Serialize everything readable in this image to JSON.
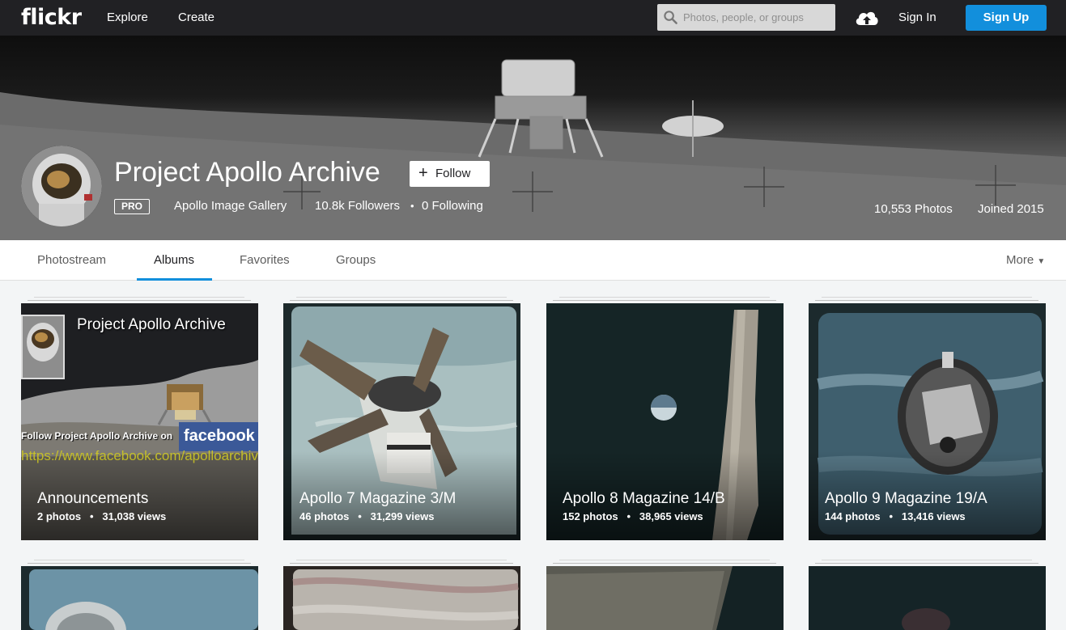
{
  "nav": {
    "logo": "flickr",
    "explore": "Explore",
    "create": "Create",
    "search_placeholder": "Photos, people, or groups",
    "sign_in": "Sign In",
    "sign_up": "Sign Up",
    "upload_icon": "cloud-upload-icon"
  },
  "profile": {
    "name": "Project Apollo Archive",
    "follow": "Follow",
    "badge": "PRO",
    "subtitle": "Apollo Image Gallery",
    "followers": "10.8k Followers",
    "following": "0 Following",
    "photos": "10,553 Photos",
    "joined": "Joined 2015"
  },
  "tabs": {
    "photostream": "Photostream",
    "albums": "Albums",
    "favorites": "Favorites",
    "groups": "Groups",
    "more": "More"
  },
  "albums": [
    {
      "title": "Announcements",
      "photos": "2 photos",
      "views": "31,038 views",
      "cover_heading": "Project Apollo Archive",
      "cover_text": "Follow Project Apollo Archive on",
      "cover_url": "https://www.facebook.com/apolloarchive",
      "cover_brand": "facebook"
    },
    {
      "title": "Apollo 7 Magazine 3/M",
      "photos": "46 photos",
      "views": "31,299 views"
    },
    {
      "title": "Apollo 8 Magazine 14/B",
      "photos": "152 photos",
      "views": "38,965 views"
    },
    {
      "title": "Apollo 9 Magazine 19/A",
      "photos": "144 photos",
      "views": "13,416 views"
    }
  ],
  "colors": {
    "nav_bg": "#212124",
    "accent": "#128fdc",
    "page_bg": "#f3f5f6"
  }
}
